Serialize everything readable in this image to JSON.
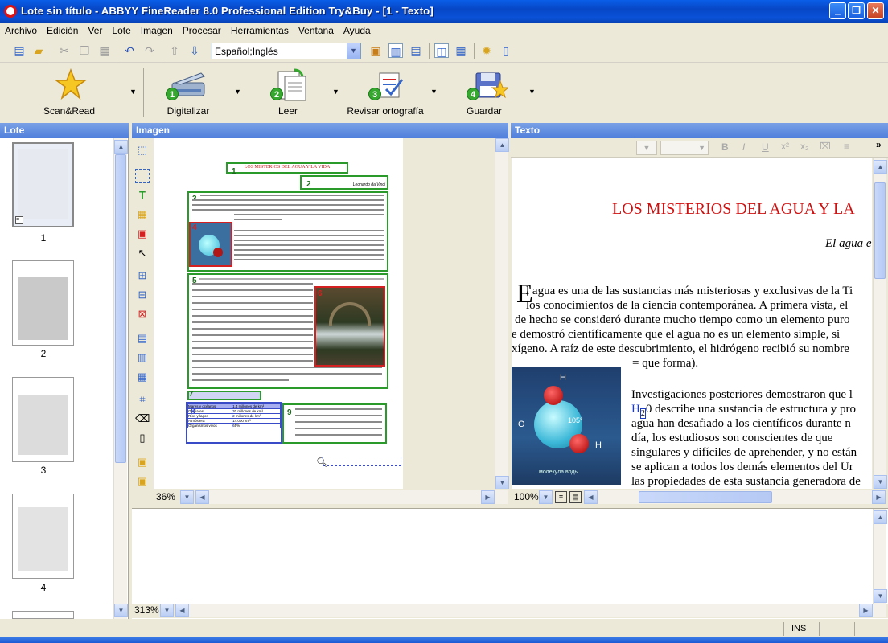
{
  "window": {
    "title": "Lote sin título - ABBYY FineReader 8.0 Professional Edition Try&Buy - [1 - Texto]"
  },
  "menu": [
    "Archivo",
    "Edición",
    "Ver",
    "Lote",
    "Imagen",
    "Procesar",
    "Herramientas",
    "Ventana",
    "Ayuda"
  ],
  "toolbar": {
    "language": "Español;Inglés"
  },
  "main_buttons": [
    {
      "label": "Scan&Read",
      "num": ""
    },
    {
      "label": "Digitalizar",
      "num": "1"
    },
    {
      "label": "Leer",
      "num": "2"
    },
    {
      "label": "Revisar ortografía",
      "num": "3"
    },
    {
      "label": "Guardar",
      "num": "4"
    }
  ],
  "panels": {
    "lote": "Lote",
    "imagen": "Imagen",
    "texto": "Texto"
  },
  "thumbnails": [
    "1",
    "2",
    "3",
    "4"
  ],
  "image_panel": {
    "zoom": "36%",
    "page": {
      "title": "LOS MISTERIOS DEL AGUA Y LA VIDA",
      "quote_author": "Leonardo da Vinci",
      "table": [
        [
          "Mares y océanos",
          "1.4 millones de km³"
        ],
        [
          "Glaciares",
          "30 millones de km³"
        ],
        [
          "Ríos y lagos",
          "2 millones de km³"
        ],
        [
          "Atmósfera",
          "14.000 km³"
        ],
        [
          "Organismos vivos",
          "65%"
        ]
      ],
      "block_nums": [
        "1",
        "2",
        "3",
        "4",
        "5",
        "6",
        "7",
        "8",
        "9"
      ]
    }
  },
  "text_panel": {
    "zoom": "100%",
    "title": "LOS MISTERIOS DEL AGUA Y LA",
    "quote": "El agua e",
    "para1": [
      "l agua es una de las sustancias más misteriosas y exclusivas de la Ti",
      "los conocimientos de la ciencia contemporánea. A primera vista, el",
      "de hecho se consideró durante mucho tiempo como un elemento puro",
      "e demostró científicamente que el agua no es un elemento simple, si",
      "xígeno. A raíz de este descubrimiento, el hidrógeno recibió su nombre",
      "= que forma)."
    ],
    "para1_dropcap": "E",
    "para2": [
      "Investigaciones posteriores demostraron que l",
      "H",
      "0 describe una sustancia de estructura y pro",
      "agua han desafiado a los científicos durante n",
      "día, los estudiosos son conscientes de que",
      "singulares y difíciles de aprehender, y no están",
      "se aplican a todos los demás elementos del Ur",
      "las propiedades de esta sustancia generadora de"
    ],
    "subscript": "2",
    "image_labels": {
      "h1": "H",
      "h2": "H",
      "o": "O",
      "angle": "105°",
      "caption": "молекула воды"
    }
  },
  "zoom_panel": {
    "zoom": "313%"
  },
  "status": {
    "ins": "INS"
  },
  "colors": {
    "title_red": "#cc1111",
    "block_green": "#2a9a2a",
    "block_red": "#d42020",
    "block_blue": "#3a4bc8"
  }
}
